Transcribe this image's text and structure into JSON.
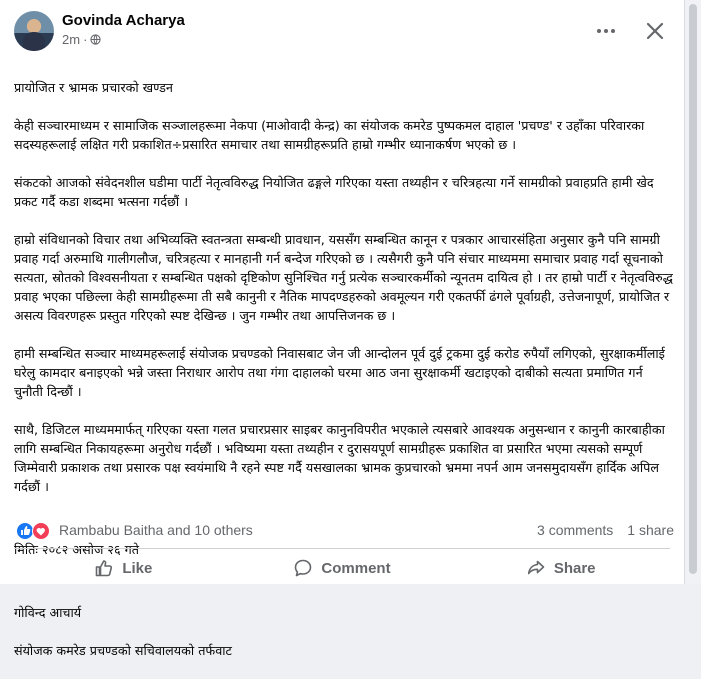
{
  "post": {
    "author": "Govinda Acharya",
    "timestamp": "2m",
    "visibility_icon": "globe-icon",
    "paragraphs": [
      "प्रायोजित र भ्रामक प्रचारको खण्डन",
      "केही सञ्चारमाध्यम र सामाजिक सञ्जालहरूमा नेकपा (माओवादी केन्द्र) का संयोजक कमरेड पुष्पकमल दाहाल 'प्रचण्ड' र उहाँका परिवारका सदस्यहरूलाई लक्षित गरी प्रकाशित÷प्रसारित समाचार तथा सामग्रीहरूप्रति हाम्रो गम्भीर ध्यानाकर्षण भएको छ ।",
      "संकटको आजको संवेदनशील घडीमा पार्टी नेतृत्वविरुद्ध नियोजित ढङ्गले गरिएका यस्ता तथ्यहीन र चरित्रहत्या गर्ने सामग्रीको प्रवाहप्रति हामी खेद प्रकट गर्दै कडा शब्दमा भत्सना गर्दछौं ।",
      "हाम्रो संविधानको विचार तथा अभिव्यक्ति स्वतन्त्रता सम्बन्धी प्रावधान, यससँग सम्बन्धित कानून र पत्रकार आचारसंहिता अनुसार कुनै पनि सामग्री प्रवाह गर्दा अरुमाथि गालीगलौज, चरित्रहत्या र मानहानी गर्न बन्देज गरिएको छ । त्यसैगरी कुनै पनि संचार माध्यममा समाचार प्रवाह गर्दा सूचनाको सत्यता, स्रोतको विश्वसनीयता र सम्बन्धित पक्षको दृष्टिकोण सुनिश्चित गर्नु प्रत्येक सञ्चारकर्मीको न्यूनतम दायित्व हो । तर हाम्रो पार्टी र नेतृत्वविरुद्ध प्रवाह भएका पछिल्ला केही सामग्रीहरूमा ती सबै कानुनी र नैतिक मापदण्डहरुको अवमूल्यन गरी एकतर्फी ढंगले पूर्वाग्रही, उत्तेजनापूर्ण, प्रायोजित र असत्य विवरणहरू प्रस्तुत गरिएको स्पष्ट देखिन्छ । जुन गम्भीर तथा आपत्तिजनक छ ।",
      "हामी सम्बन्धित सञ्चार माध्यमहरूलाई संयोजक प्रचण्डको निवासबाट जेन जी आन्दोलन पूर्व दुई ट्रकमा दुई करोड रुपैयाँ लगिएको, सुरक्षाकर्मीलाई घरेलु कामदार बनाइएको भन्ने जस्ता निराधार आरोप तथा गंगा दाहालको घरमा आठ जना सुरक्षाकर्मी खटाइएको दाबीको सत्यता प्रमाणित गर्न चुनौती दिन्छौं ।",
      "साथै, डिजिटल माध्यममार्फत् गरिएका यस्ता गलत प्रचारप्रसार साइबर कानुनविपरीत भएकाले त्यसबारे आवश्यक अनुसन्धान र कानुनी कारबाहीका लागि सम्बन्धित निकायहरूमा अनुरोध गर्दछौं । भविष्यमा यस्ता तथ्यहीन र दुरासयपूर्ण सामग्रीहरू प्रकाशित वा प्रसारित भएमा त्यसको सम्पूर्ण जिम्मेवारी प्रकाशक तथा प्रसारक पक्ष स्वयंमाथि नै रहने स्पष्ट गर्दै यसखालका भ्रामक कुप्रचारको भ्रममा नपर्न आम जनसमुदायसँग हार्दिक अपिल गर्दछौं ।"
    ],
    "date_line": "मितिः २०८२ असोज २६ गते",
    "signature_name": "गोविन्द आचार्य",
    "signature_office": "संयोजक कमरेड प्रचण्डको सचिवालयको तर्फवाट"
  },
  "reactions": {
    "icons": [
      "like-icon",
      "love-icon"
    ],
    "names": "Rambabu Baitha and 10 others",
    "comments": "3 comments",
    "shares": "1 share"
  },
  "actions": {
    "like": "Like",
    "comment": "Comment",
    "share": "Share"
  },
  "colors": {
    "like_blue": "#1877f2",
    "love_red": "#f33e58",
    "secondary_text": "#65676b"
  }
}
